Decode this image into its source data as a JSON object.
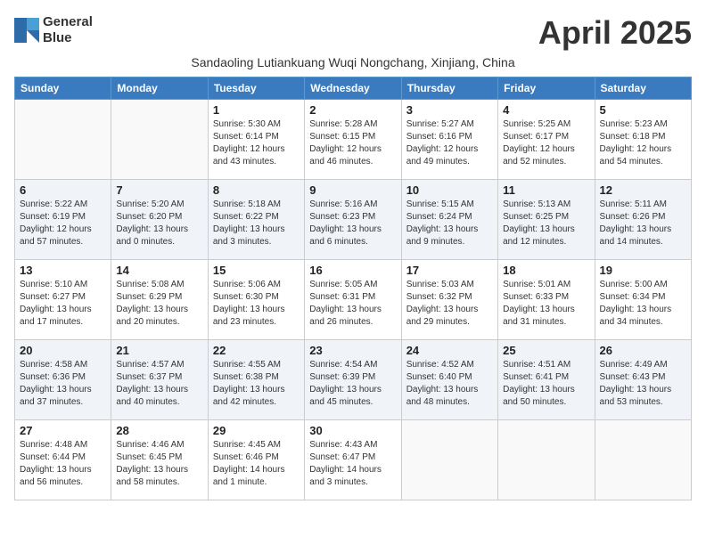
{
  "header": {
    "logo_line1": "General",
    "logo_line2": "Blue",
    "month_title": "April 2025",
    "subtitle": "Sandaoling Lutiankuang Wuqi Nongchang, Xinjiang, China"
  },
  "weekdays": [
    "Sunday",
    "Monday",
    "Tuesday",
    "Wednesday",
    "Thursday",
    "Friday",
    "Saturday"
  ],
  "weeks": [
    [
      {
        "day": "",
        "info": ""
      },
      {
        "day": "",
        "info": ""
      },
      {
        "day": "1",
        "info": "Sunrise: 5:30 AM\nSunset: 6:14 PM\nDaylight: 12 hours and 43 minutes."
      },
      {
        "day": "2",
        "info": "Sunrise: 5:28 AM\nSunset: 6:15 PM\nDaylight: 12 hours and 46 minutes."
      },
      {
        "day": "3",
        "info": "Sunrise: 5:27 AM\nSunset: 6:16 PM\nDaylight: 12 hours and 49 minutes."
      },
      {
        "day": "4",
        "info": "Sunrise: 5:25 AM\nSunset: 6:17 PM\nDaylight: 12 hours and 52 minutes."
      },
      {
        "day": "5",
        "info": "Sunrise: 5:23 AM\nSunset: 6:18 PM\nDaylight: 12 hours and 54 minutes."
      }
    ],
    [
      {
        "day": "6",
        "info": "Sunrise: 5:22 AM\nSunset: 6:19 PM\nDaylight: 12 hours and 57 minutes."
      },
      {
        "day": "7",
        "info": "Sunrise: 5:20 AM\nSunset: 6:20 PM\nDaylight: 13 hours and 0 minutes."
      },
      {
        "day": "8",
        "info": "Sunrise: 5:18 AM\nSunset: 6:22 PM\nDaylight: 13 hours and 3 minutes."
      },
      {
        "day": "9",
        "info": "Sunrise: 5:16 AM\nSunset: 6:23 PM\nDaylight: 13 hours and 6 minutes."
      },
      {
        "day": "10",
        "info": "Sunrise: 5:15 AM\nSunset: 6:24 PM\nDaylight: 13 hours and 9 minutes."
      },
      {
        "day": "11",
        "info": "Sunrise: 5:13 AM\nSunset: 6:25 PM\nDaylight: 13 hours and 12 minutes."
      },
      {
        "day": "12",
        "info": "Sunrise: 5:11 AM\nSunset: 6:26 PM\nDaylight: 13 hours and 14 minutes."
      }
    ],
    [
      {
        "day": "13",
        "info": "Sunrise: 5:10 AM\nSunset: 6:27 PM\nDaylight: 13 hours and 17 minutes."
      },
      {
        "day": "14",
        "info": "Sunrise: 5:08 AM\nSunset: 6:29 PM\nDaylight: 13 hours and 20 minutes."
      },
      {
        "day": "15",
        "info": "Sunrise: 5:06 AM\nSunset: 6:30 PM\nDaylight: 13 hours and 23 minutes."
      },
      {
        "day": "16",
        "info": "Sunrise: 5:05 AM\nSunset: 6:31 PM\nDaylight: 13 hours and 26 minutes."
      },
      {
        "day": "17",
        "info": "Sunrise: 5:03 AM\nSunset: 6:32 PM\nDaylight: 13 hours and 29 minutes."
      },
      {
        "day": "18",
        "info": "Sunrise: 5:01 AM\nSunset: 6:33 PM\nDaylight: 13 hours and 31 minutes."
      },
      {
        "day": "19",
        "info": "Sunrise: 5:00 AM\nSunset: 6:34 PM\nDaylight: 13 hours and 34 minutes."
      }
    ],
    [
      {
        "day": "20",
        "info": "Sunrise: 4:58 AM\nSunset: 6:36 PM\nDaylight: 13 hours and 37 minutes."
      },
      {
        "day": "21",
        "info": "Sunrise: 4:57 AM\nSunset: 6:37 PM\nDaylight: 13 hours and 40 minutes."
      },
      {
        "day": "22",
        "info": "Sunrise: 4:55 AM\nSunset: 6:38 PM\nDaylight: 13 hours and 42 minutes."
      },
      {
        "day": "23",
        "info": "Sunrise: 4:54 AM\nSunset: 6:39 PM\nDaylight: 13 hours and 45 minutes."
      },
      {
        "day": "24",
        "info": "Sunrise: 4:52 AM\nSunset: 6:40 PM\nDaylight: 13 hours and 48 minutes."
      },
      {
        "day": "25",
        "info": "Sunrise: 4:51 AM\nSunset: 6:41 PM\nDaylight: 13 hours and 50 minutes."
      },
      {
        "day": "26",
        "info": "Sunrise: 4:49 AM\nSunset: 6:43 PM\nDaylight: 13 hours and 53 minutes."
      }
    ],
    [
      {
        "day": "27",
        "info": "Sunrise: 4:48 AM\nSunset: 6:44 PM\nDaylight: 13 hours and 56 minutes."
      },
      {
        "day": "28",
        "info": "Sunrise: 4:46 AM\nSunset: 6:45 PM\nDaylight: 13 hours and 58 minutes."
      },
      {
        "day": "29",
        "info": "Sunrise: 4:45 AM\nSunset: 6:46 PM\nDaylight: 14 hours and 1 minute."
      },
      {
        "day": "30",
        "info": "Sunrise: 4:43 AM\nSunset: 6:47 PM\nDaylight: 14 hours and 3 minutes."
      },
      {
        "day": "",
        "info": ""
      },
      {
        "day": "",
        "info": ""
      },
      {
        "day": "",
        "info": ""
      }
    ]
  ]
}
